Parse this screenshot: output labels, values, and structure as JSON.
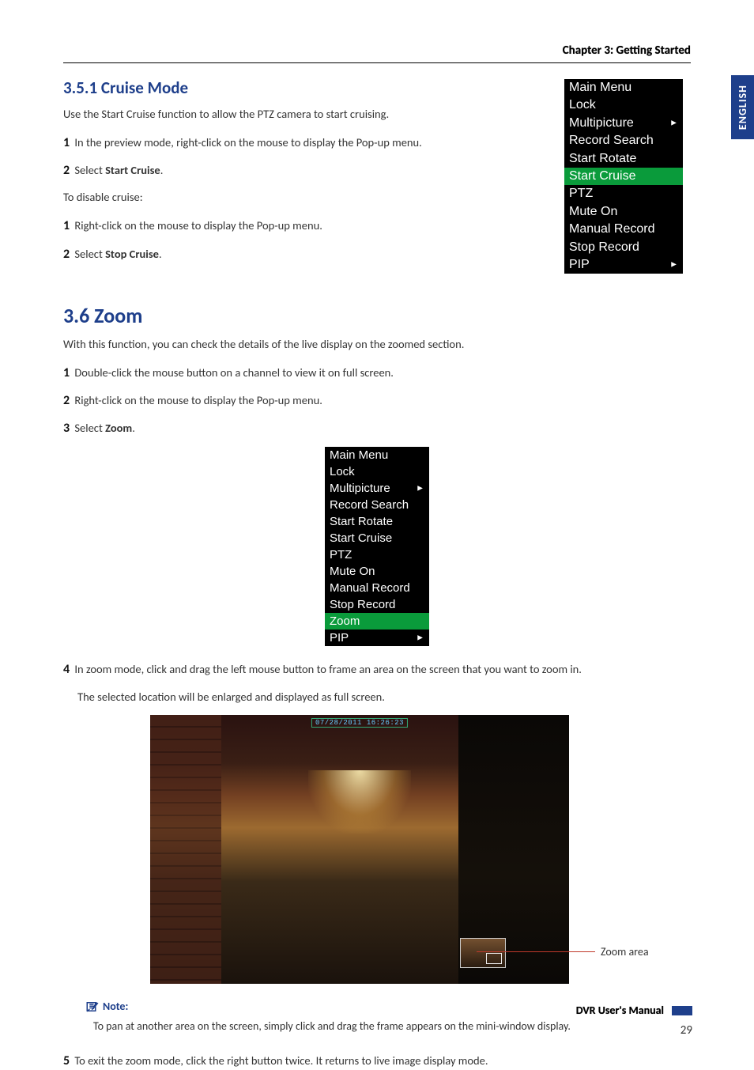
{
  "header": {
    "chapter": "Chapter 3: Getting Started"
  },
  "lang_tab": "ENGLISH",
  "s351": {
    "title": "3.5.1 Cruise Mode",
    "intro": "Use the Start Cruise function to allow the PTZ camera to start cruising.",
    "step1_pre": "In the preview mode, right-click on the mouse to display the Pop-up menu.",
    "step2_pre": "Select ",
    "step2_bold": "Start Cruise",
    "step2_post": ".",
    "disable": "To disable cruise:",
    "dstep1": "Right-click on the mouse to display the Pop-up menu.",
    "dstep2_pre": "Select ",
    "dstep2_bold": "Stop Cruise",
    "dstep2_post": "."
  },
  "s36": {
    "title": "3.6 Zoom",
    "intro": "With this function, you can check the details of the live display on the zoomed section.",
    "step1": "Double-click the mouse button on a channel to view it on full screen.",
    "step2": "Right-click on the mouse to display the Pop-up menu.",
    "step3_pre": "Select ",
    "step3_bold": "Zoom",
    "step3_post": ".",
    "step4": "In zoom mode, click and drag the left mouse button to frame an area on the screen that you want to zoom in.",
    "step4b": "The selected location will be enlarged and displayed as full screen.",
    "step5": "To exit the zoom mode, click the right button twice. It returns to live image display mode."
  },
  "menu1": {
    "items": [
      "Main Menu",
      "Lock",
      "Multipicture",
      "Record Search",
      "Start Rotate",
      "Start Cruise",
      "PTZ",
      "Mute On",
      "Manual Record",
      "Stop Record",
      "PIP"
    ],
    "highlight_index": 5,
    "submenu_indices": [
      2,
      10
    ]
  },
  "menu2": {
    "items": [
      "Main Menu",
      "Lock",
      "Multipicture",
      "Record Search",
      "Start Rotate",
      "Start Cruise",
      "PTZ",
      "Mute On",
      "Manual Record",
      "Stop Record",
      "Zoom",
      "PIP"
    ],
    "highlight_index": 10,
    "submenu_indices": [
      2,
      11
    ]
  },
  "fig": {
    "timestamp": "07/28/2011 16:26:23",
    "callout": "Zoom area"
  },
  "note": {
    "label": "Note:",
    "text": "To pan at another area on the screen, simply click and drag the frame appears on the mini-window display."
  },
  "footer": {
    "manual": "DVR User's Manual",
    "page": "29"
  },
  "nums": {
    "n1": "1",
    "n2": "2",
    "n3": "3",
    "n4": "4",
    "n5": "5"
  }
}
